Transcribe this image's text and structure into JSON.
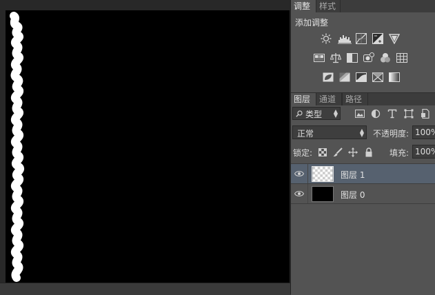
{
  "adjustments": {
    "tabs": [
      {
        "label": "调整",
        "active": true
      },
      {
        "label": "样式",
        "active": false
      }
    ],
    "title": "添加调整",
    "rows": [
      [
        "brightness-contrast-icon",
        "levels-icon",
        "curves-icon",
        "exposure-icon",
        "vibrance-icon"
      ],
      [
        "hue-saturation-icon",
        "color-balance-icon",
        "black-white-icon",
        "photo-filter-icon",
        "channel-mixer-icon",
        "color-lookup-icon"
      ],
      [
        "invert-icon",
        "posterize-icon",
        "threshold-icon",
        "selective-color-icon",
        "gradient-map-icon"
      ]
    ]
  },
  "layers_panel": {
    "tabs": [
      {
        "label": "图层",
        "active": true
      },
      {
        "label": "通道",
        "active": false
      },
      {
        "label": "路径",
        "active": false
      }
    ],
    "filter_kind": "类型",
    "blend_mode": "正常",
    "opacity_label": "不透明度:",
    "opacity_value": "100%",
    "lock_label": "锁定:",
    "fill_label": "填充:",
    "fill_value": "100%",
    "layers": [
      {
        "name": "图层 1",
        "selected": true,
        "thumbnail": "transparent"
      },
      {
        "name": "图层 0",
        "selected": false,
        "thumbnail": "black"
      }
    ]
  },
  "colors": {
    "panel_bg": "#535353",
    "selected_layer": "#56616f",
    "canvas": "#000000",
    "brush_stroke": "#ffffff"
  }
}
